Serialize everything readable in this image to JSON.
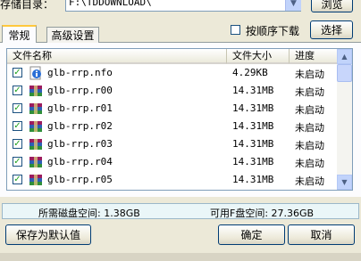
{
  "dir": {
    "label": "存储目录：",
    "value": "F:\\TDDOWNLOAD\\",
    "browse_label": "浏览"
  },
  "tabs": [
    {
      "label": "常规"
    },
    {
      "label": "高级设置"
    }
  ],
  "sequential": {
    "label": "按顺序下载",
    "checked": false
  },
  "select_label": "选择",
  "columns": {
    "name": "文件名称",
    "size": "文件大小",
    "progress": "进度"
  },
  "files": [
    {
      "name": "glb-rrp.nfo",
      "size": "4.29KB",
      "status": "未启动",
      "icon": "nfo-info-icon"
    },
    {
      "name": "glb-rrp.r00",
      "size": "14.31MB",
      "status": "未启动",
      "icon": "rar-archive-icon"
    },
    {
      "name": "glb-rrp.r01",
      "size": "14.31MB",
      "status": "未启动",
      "icon": "rar-archive-icon"
    },
    {
      "name": "glb-rrp.r02",
      "size": "14.31MB",
      "status": "未启动",
      "icon": "rar-archive-icon"
    },
    {
      "name": "glb-rrp.r03",
      "size": "14.31MB",
      "status": "未启动",
      "icon": "rar-archive-icon"
    },
    {
      "name": "glb-rrp.r04",
      "size": "14.31MB",
      "status": "未启动",
      "icon": "rar-archive-icon"
    },
    {
      "name": "glb-rrp.r05",
      "size": "14.31MB",
      "status": "未启动",
      "icon": "rar-archive-icon"
    }
  ],
  "status": {
    "required": "所需磁盘空间: 1.38GB",
    "available": "可用F盘空间: 27.36GB"
  },
  "buttons": {
    "save_default": "保存为默认值",
    "ok": "确定",
    "cancel": "取消"
  }
}
